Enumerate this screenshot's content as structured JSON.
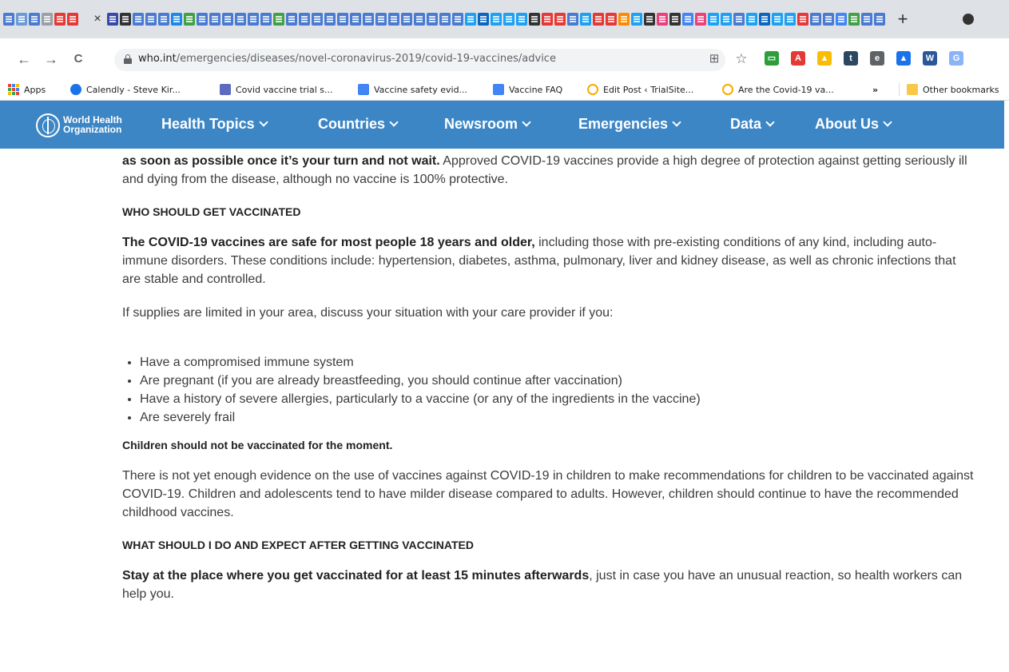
{
  "browser": {
    "tab_icon_colors": [
      "#4a7bd0",
      "#6a9ad8",
      "#4a7bd0",
      "#9aa0a6",
      "#e53935",
      "#e53935",
      "#3949ab",
      "#333333",
      "#4a7bd0",
      "#4a7bd0",
      "#4a7bd0",
      "#1e88e5",
      "#43a047",
      "#4a7bd0",
      "#4a7bd0",
      "#4a7bd0",
      "#4a7bd0",
      "#4a7bd0",
      "#4a7bd0",
      "#43a047",
      "#4a7bd0",
      "#4a7bd0",
      "#4a7bd0",
      "#4a7bd0",
      "#4a7bd0",
      "#4a7bd0",
      "#4a7bd0",
      "#4a7bd0",
      "#4a7bd0",
      "#4a7bd0",
      "#4a7bd0",
      "#4a7bd0",
      "#4a7bd0",
      "#4a7bd0",
      "#1da1f2",
      "#0a66c2",
      "#1da1f2",
      "#1da1f2",
      "#1da1f2",
      "#333333",
      "#e53935",
      "#e53935",
      "#4a7bd0",
      "#1da1f2",
      "#e53935",
      "#e53935",
      "#fb8c00",
      "#1da1f2",
      "#333333",
      "#ec407a",
      "#333333",
      "#4285f4",
      "#ec407a",
      "#1da1f2",
      "#1da1f2",
      "#4a7bd0",
      "#1da1f2",
      "#0a66c2",
      "#1da1f2",
      "#1da1f2",
      "#e53935",
      "#4a7bd0",
      "#4a7bd0",
      "#4285f4",
      "#43a047",
      "#4a7bd0",
      "#4a7bd0"
    ],
    "close_tab_glyph": "×",
    "new_tab_glyph": "+",
    "back_glyph": "←",
    "forward_glyph": "→",
    "reload_glyph": "C",
    "url_domain": "who.int",
    "url_path": "/emergencies/diseases/novel-coronavirus-2019/covid-19-vaccines/advice",
    "star_glyph": "☆",
    "qr_glyph": "⊞",
    "extensions": [
      {
        "name": "zoom-extension",
        "color": "#2e9e3a",
        "glyph": "▭"
      },
      {
        "name": "acrobat-extension",
        "color": "#e53935",
        "glyph": "A"
      },
      {
        "name": "drive-extension",
        "color": "#fbbc04",
        "glyph": "▲"
      },
      {
        "name": "tumblr-extension",
        "color": "#2c4762",
        "glyph": "t"
      },
      {
        "name": "evernote-extension",
        "color": "#5f6368",
        "glyph": "e"
      },
      {
        "name": "drive-alt-extension",
        "color": "#1a73e8",
        "glyph": "▲"
      },
      {
        "name": "word-extension",
        "color": "#2b579a",
        "glyph": "W"
      },
      {
        "name": "translate-extension",
        "color": "#8ab4f8",
        "glyph": "G"
      }
    ],
    "bookmarks": [
      {
        "label": "Apps",
        "icon": "apps-grid"
      },
      {
        "label": "Calendly - Steve Kir...",
        "icon": "calendly-icon",
        "color": "#1a73e8"
      },
      {
        "label": "Covid vaccine trial s...",
        "icon": "calendar-icon",
        "color": "#5c6bc0"
      },
      {
        "label": "Vaccine safety evid...",
        "icon": "docs-icon",
        "color": "#4285f4"
      },
      {
        "label": "Vaccine FAQ",
        "icon": "docs-icon",
        "color": "#4285f4"
      },
      {
        "label": "Edit Post ‹ TrialSite...",
        "icon": "trialsite-icon",
        "color": "#f9ab00"
      },
      {
        "label": "Are the Covid-19 va...",
        "icon": "trialsite-icon",
        "color": "#f9ab00"
      }
    ],
    "bookmarks_overflow": "»",
    "other_bookmarks": "Other bookmarks"
  },
  "site": {
    "org_line1": "World Health",
    "org_line2": "Organization",
    "nav": [
      "Health Topics",
      "Countries",
      "Newsroom",
      "Emergencies",
      "Data",
      "About Us"
    ]
  },
  "article": {
    "intro_bold": "as soon as possible once it’s your turn and not wait.",
    "intro_rest": " Approved COVID-19 vaccines provide a high degree of protection against getting seriously ill and dying from the disease, although no vaccine is 100% protective.",
    "h_who": "WHO SHOULD GET VACCINATED",
    "safe_bold": "The COVID-19 vaccines are safe for most people 18 years and olde",
    "safe_bold_r": "r,",
    "safe_rest": " including those with pre-existing conditions of any kind, including auto-immune disorders. These conditions include: hypertension, diabetes, asthma, pulmonary, liver and kidney disease, as well as chronic infections that are stable and controlled.",
    "limited": "If supplies are limited in your area, discuss your situation with your care provider if you:",
    "bullets": [
      "Have a compromised immune system",
      "Are pregnant (if you are already breastfeeding, you should continue after vaccination)",
      "Have a history of severe allergies, particularly to a vaccine (or any of the ingredients in the vaccine)",
      "Are severely frail"
    ],
    "children_heading": "Children should not be vaccinated for the moment.",
    "children_text": "There is not yet enough evidence on the use of vaccines against COVID-19 in children to make recommendations for children to be vaccinated against COVID-19. Children and adolescents tend to have milder disease compared to adults. However, children should continue to have the recommended childhood vaccines.",
    "h_after": "WHAT SHOULD I DO AND EXPECT AFTER GETTING VACCINATED",
    "stay_bold": "Stay at the place where you get vaccinated for at least 15 minutes afterwards",
    "stay_rest": ", just in case you have an unusual reaction, so health workers can help you."
  }
}
